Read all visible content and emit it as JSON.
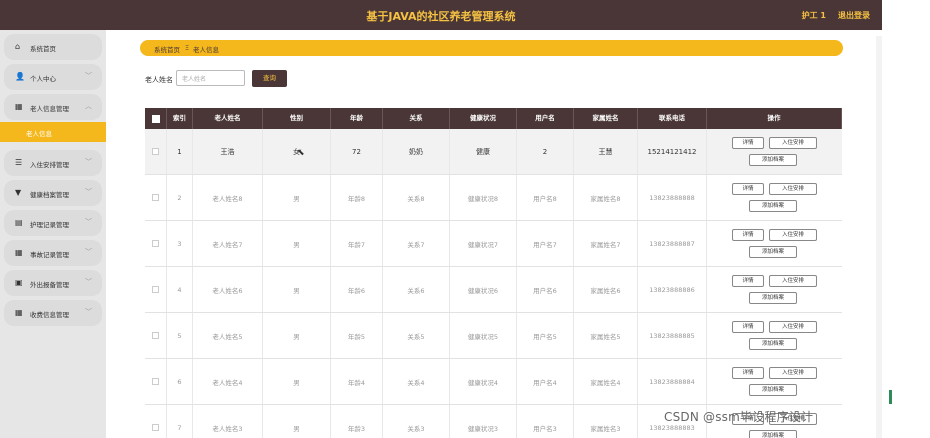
{
  "header": {
    "title": "基于JAVA的社区养老管理系统",
    "user": "护工 1",
    "logout": "退出登录"
  },
  "sidebar": {
    "items": [
      {
        "icon": "⌂",
        "label": "系统首页"
      },
      {
        "icon": "👤",
        "label": "个人中心"
      },
      {
        "icon": "▦",
        "label": "老人信息管理"
      },
      {
        "icon": "☰",
        "label": "入住安排管理"
      },
      {
        "icon": "▼",
        "label": "健康档案管理"
      },
      {
        "icon": "▤",
        "label": "护理记录管理"
      },
      {
        "icon": "▦",
        "label": "事故记录管理"
      },
      {
        "icon": "▣",
        "label": "外出报备管理"
      },
      {
        "icon": "▦",
        "label": "收费信息管理"
      }
    ],
    "active_sub": "老人信息"
  },
  "breadcrumb": {
    "home": "系统首页",
    "sep": "Ξ",
    "current": "老人信息"
  },
  "search": {
    "label": "老人姓名",
    "placeholder": "老人姓名",
    "button": "查询"
  },
  "table": {
    "headers": [
      "",
      "索引",
      "老人姓名",
      "性别",
      "年龄",
      "关系",
      "健康状况",
      "用户名",
      "家属姓名",
      "联系电话",
      "操作"
    ],
    "rows": [
      [
        "1",
        "王浩",
        "女",
        "72",
        "奶奶",
        "健康",
        "2",
        "王慧",
        "15214121412"
      ],
      [
        "2",
        "老人姓名8",
        "男",
        "年龄8",
        "关系8",
        "健康状况8",
        "用户名8",
        "家属姓名8",
        "13823888888"
      ],
      [
        "3",
        "老人姓名7",
        "男",
        "年龄7",
        "关系7",
        "健康状况7",
        "用户名7",
        "家属姓名7",
        "13823888887"
      ],
      [
        "4",
        "老人姓名6",
        "男",
        "年龄6",
        "关系6",
        "健康状况6",
        "用户名6",
        "家属姓名6",
        "13823888886"
      ],
      [
        "5",
        "老人姓名5",
        "男",
        "年龄5",
        "关系5",
        "健康状况5",
        "用户名5",
        "家属姓名5",
        "13823888885"
      ],
      [
        "6",
        "老人姓名4",
        "男",
        "年龄4",
        "关系4",
        "健康状况4",
        "用户名4",
        "家属姓名4",
        "13823888884"
      ],
      [
        "7",
        "老人姓名3",
        "男",
        "年龄3",
        "关系3",
        "健康状况3",
        "用户名3",
        "家属姓名3",
        "13823888883"
      ]
    ],
    "ops": {
      "detail": "详情",
      "arrange": "入住安排",
      "archive": "添加档案"
    }
  },
  "watermark": "CSDN @ssm毕设程序设计"
}
